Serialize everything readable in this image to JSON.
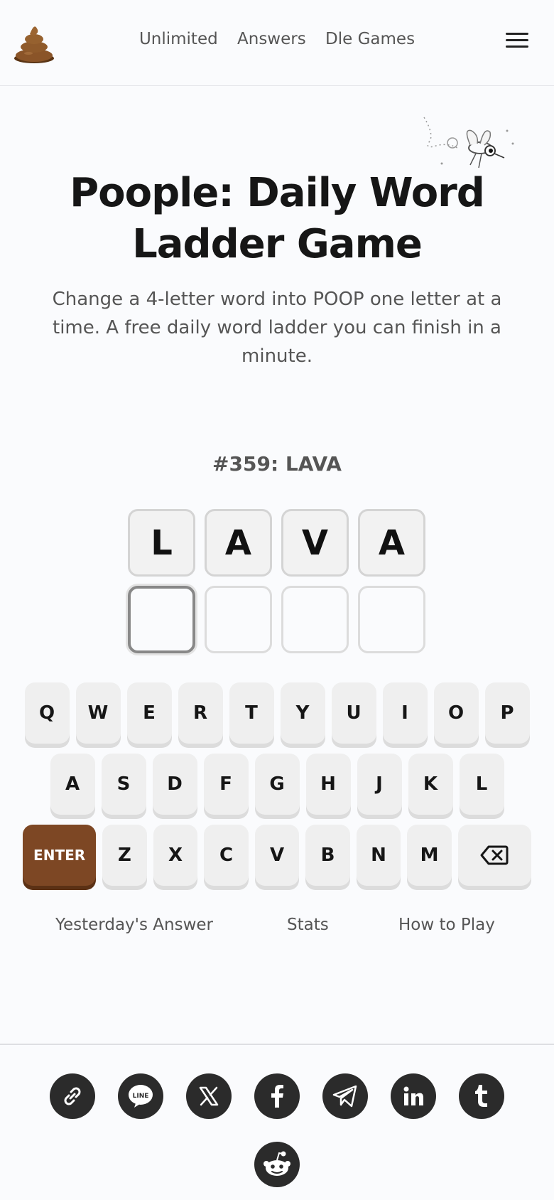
{
  "header": {
    "logo_icon": "poop-emoji-icon",
    "nav": [
      "Unlimited",
      "Answers",
      "Dle Games"
    ],
    "menu_icon": "hamburger-menu-icon"
  },
  "hero": {
    "title_line1": "Poople: Daily Word",
    "title_line2": "Ladder Game",
    "subtitle": "Change a 4-letter word into POOP one letter at a time. A free daily word ladder you can finish in a minute."
  },
  "game": {
    "puzzle_label": "#359: LAVA",
    "start_word": [
      "L",
      "A",
      "V",
      "A"
    ],
    "guess_row": [
      "",
      "",
      "",
      ""
    ]
  },
  "keyboard": {
    "row1": [
      "Q",
      "W",
      "E",
      "R",
      "T",
      "Y",
      "U",
      "I",
      "O",
      "P"
    ],
    "row2": [
      "A",
      "S",
      "D",
      "F",
      "G",
      "H",
      "J",
      "K",
      "L"
    ],
    "row3": [
      "Z",
      "X",
      "C",
      "V",
      "B",
      "N",
      "M"
    ],
    "enter_label": "ENTER",
    "enter_color": "#7d4724",
    "backspace_icon": "backspace-icon"
  },
  "links": {
    "yesterday": "Yesterday's Answer",
    "stats": "Stats",
    "how_to_play": "How to Play"
  },
  "share": [
    "link-icon",
    "line-icon",
    "x-icon",
    "facebook-icon",
    "telegram-icon",
    "linkedin-icon",
    "tumblr-icon",
    "reddit-icon"
  ]
}
